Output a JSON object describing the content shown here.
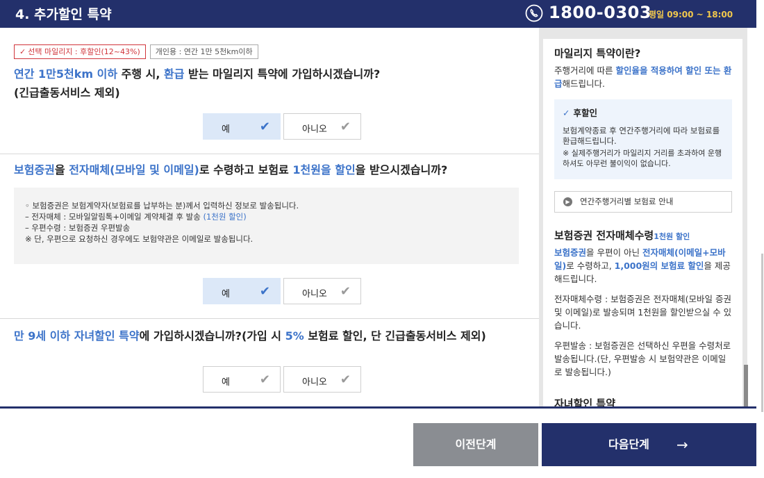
{
  "header": {
    "title": "4. 추가할인 특약",
    "phone": "1800-0303",
    "hours": "평일 09:00 ~ 18:00"
  },
  "section1": {
    "badge_selected": "선택 마일리지 : 후할인(12~43%)",
    "badge_personal": "개인용 : 연간 1만 5천km이하",
    "question_parts": [
      "연간 1만5천km 이하",
      " 주행 시, ",
      "환급",
      " 받는 마일리지 특약에 가입하시겠습니까?"
    ],
    "question_sub": "(긴급출동서비스 제외)",
    "yes": "예",
    "no": "아니오"
  },
  "section2": {
    "question_parts": [
      "보험증권",
      "을 ",
      "전자매체(모바일 및 이메일)",
      "로 수령하고 보험료 ",
      "1천원을 할인",
      "을 받으시겠습니까?"
    ],
    "info_lines": [
      "◦ 보험증권은 보험계약자(보험료를 납부하는 분)께서 입력하신 정보로 발송됩니다.",
      "– 전자매체 : 모바일알림톡+이메일 계약체결 후 발송 ",
      "(1천원 할인)",
      "– 우편수령 : 보험증권 우편발송",
      "※ 단, 우편으로 요청하신 경우에도 보험약관은 이메일로 발송됩니다."
    ],
    "yes": "예",
    "no": "아니오"
  },
  "section3": {
    "question_parts": [
      "만 9세 이하 자녀할인 특약",
      "에 가입하시겠습니까?(가입 시 ",
      "5%",
      " 보험료 할인, 단 긴급출동서비스 제외)"
    ],
    "yes": "예",
    "no": "아니오"
  },
  "sidebar": {
    "mileage_title": "마일리지 특약이란?",
    "mileage_desc_parts": [
      "주행거리에 따른 ",
      "할인율을 적용하여 할인 또는 환급",
      "해드립니다."
    ],
    "box_title": "후할인",
    "box_body": "보험계약종료 후 연간주행거리에 따라 보험료를 환급해드립니다.",
    "box_note": "※ 실제주행거리가 마일리지 거리를 초과하여 운행하셔도 아무런 불이익이 없습니다.",
    "link_label": "연간주행거리별 보험료 안내",
    "ecert_title": "보험증권 전자매체수령",
    "ecert_badge": "1천원 할인",
    "ecert_desc_parts": [
      "보험증권",
      "을 우편이 아닌 ",
      "전자매체(이메일+모바일)",
      "로 수령하고, ",
      "1,000원의 보험료 할인",
      "을 제공해드립니다."
    ],
    "ecert_text1": "전자매체수령 : 보험증권은 전자매체(모바일 증권 및 이메일)로 발송되며 1천원을 할인받으실 수 있습니다.",
    "ecert_text2": "우편발송 : 보험증권은 선택하신 우편을 수령처로 발송됩니다.(단, 우편발송 시 보험약관은 이메일로 발송됩니다.)",
    "child_title": "자녀할인 특약"
  },
  "footer": {
    "prev_label": "이전단계",
    "next_label": "다음단계",
    "next_arrow": "→"
  },
  "colors": {
    "navy": "#23306b",
    "accent_blue": "#3c73c9",
    "badge_red": "#d0343a",
    "hours_yellow": "#f2c94c",
    "prev_gray": "#8a8d92"
  }
}
